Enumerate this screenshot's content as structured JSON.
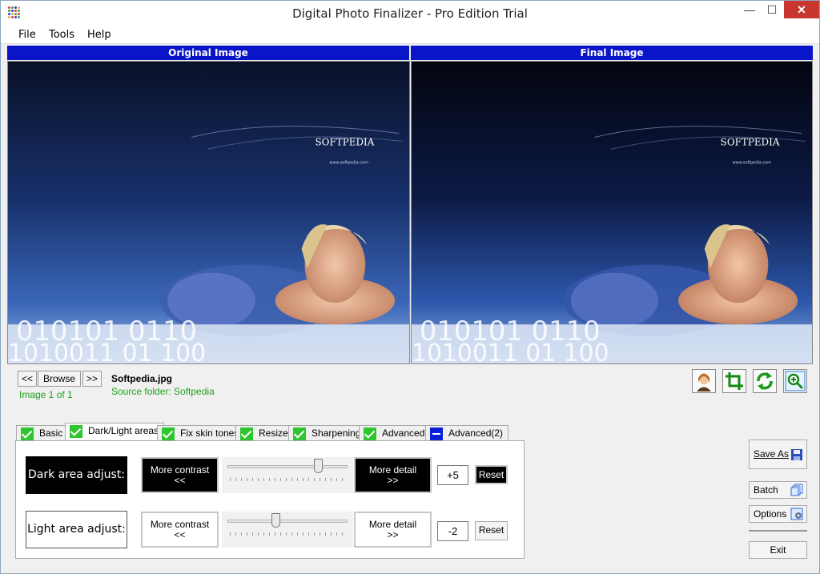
{
  "window": {
    "title": "Digital Photo Finalizer - Pro Edition Trial",
    "controls": {
      "minimize": "—",
      "maximize": "☐",
      "close": "✕"
    }
  },
  "menu": [
    "File",
    "Tools",
    "Help"
  ],
  "panels": {
    "original_title": "Original Image",
    "final_title": "Final Image",
    "watermark": "SOFTPEDIA",
    "watermark_url": "www.softpedia.com"
  },
  "navigation": {
    "prev_label": "<<",
    "browse_label": "Browse",
    "next_label": ">>",
    "file_name": "Softpedia.jpg",
    "image_count": "Image 1 of 1",
    "source_folder": "Source folder: Softpedia"
  },
  "toolbar_icons": [
    "portrait-icon",
    "crop-icon",
    "rotate-icon",
    "zoom-icon"
  ],
  "tabs": [
    {
      "label": "Basic",
      "state": "checked"
    },
    {
      "label": "Dark/Light areas",
      "state": "checked",
      "active": true
    },
    {
      "label": "Fix skin tones",
      "state": "checked"
    },
    {
      "label": "Resize",
      "state": "checked"
    },
    {
      "label": "Sharpening",
      "state": "checked"
    },
    {
      "label": "Advanced",
      "state": "checked"
    },
    {
      "label": "Advanced(2)",
      "state": "minus"
    }
  ],
  "dark_area": {
    "label": "Dark area adjust:",
    "more_contrast": "More contrast",
    "contrast_arrow": "<<",
    "more_detail": "More detail",
    "detail_arrow": ">>",
    "value": "+5",
    "slider_position": 0.75,
    "reset": "Reset"
  },
  "light_area": {
    "label": "Light area adjust:",
    "more_contrast": "More contrast",
    "contrast_arrow": "<<",
    "more_detail": "More detail",
    "detail_arrow": ">>",
    "value": "-2",
    "slider_position": 0.4,
    "reset": "Reset"
  },
  "side_buttons": {
    "save_as": "Save As",
    "batch": "Batch",
    "options": "Options",
    "exit": "Exit"
  },
  "colors": {
    "header_blue": "#0a14c8",
    "status_green": "#1fa01f",
    "close_red": "#c7372f",
    "tab_check_green": "#2ec52e"
  }
}
